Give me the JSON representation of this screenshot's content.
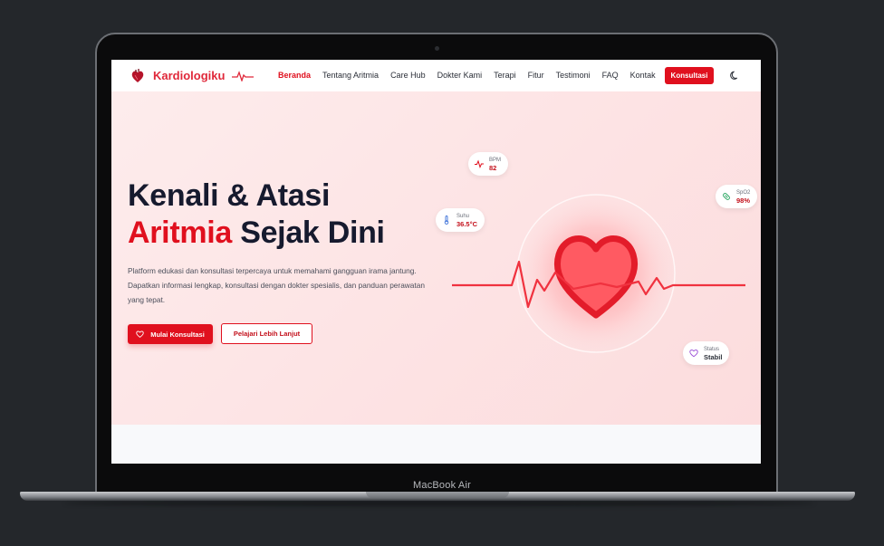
{
  "device": {
    "label": "MacBook Air"
  },
  "brand": {
    "name": "Kardiologiku"
  },
  "nav": {
    "items": [
      "Beranda",
      "Tentang Aritmia",
      "Care Hub",
      "Dokter Kami",
      "Terapi",
      "Fitur",
      "Testimoni",
      "FAQ",
      "Kontak"
    ],
    "active": "Beranda",
    "cta_label": "Konsultasi"
  },
  "hero": {
    "title_line1": "Kenali & Atasi",
    "title_accent": "Aritmia",
    "title_rest": " Sejak Dini",
    "description": "Platform edukasi dan konsultasi terpercaya untuk memahami gangguan irama jantung. Dapatkan informasi lengkap, konsultasi dengan dokter spesialis, dan panduan perawatan yang tepat.",
    "primary_button": "Mulai Konsultasi",
    "secondary_button": "Pelajari Lebih Lanjut"
  },
  "vitals": {
    "bpm": {
      "label": "BPM",
      "value": "82",
      "icon": "pulse-icon"
    },
    "temp": {
      "label": "Suhu",
      "value": "36.5°C",
      "icon": "thermometer-icon"
    },
    "spo2": {
      "label": "SpO2",
      "value": "98%",
      "icon": "pill-icon"
    },
    "status": {
      "label": "Status",
      "value": "Stabil",
      "icon": "heart-outline-icon"
    }
  },
  "colors": {
    "accent": "#e0101e",
    "heading": "#161a2e",
    "hero_bg": "#fde3e4"
  }
}
